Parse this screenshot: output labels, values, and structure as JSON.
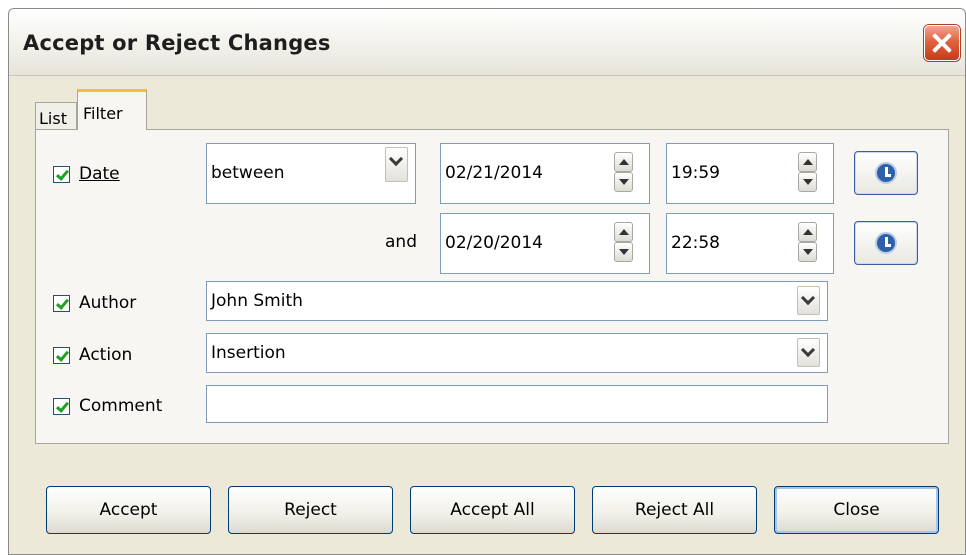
{
  "window": {
    "title": "Accept or Reject Changes"
  },
  "tabs": [
    {
      "label": "List"
    },
    {
      "label": "Filter"
    }
  ],
  "filter": {
    "date": {
      "label": "Date",
      "checked": true,
      "mode": "between",
      "start_date": "02/21/2014",
      "start_time": "19:59",
      "and_label": "and",
      "end_date": "02/20/2014",
      "end_time": "22:58"
    },
    "author": {
      "label": "Author",
      "checked": true,
      "value": "John Smith"
    },
    "action": {
      "label": "Action",
      "checked": true,
      "value": "Insertion"
    },
    "comment": {
      "label": "Comment",
      "checked": true,
      "value": ""
    }
  },
  "buttons": {
    "accept": "Accept",
    "reject": "Reject",
    "accept_all": "Accept All",
    "reject_all": "Reject All",
    "close": "Close"
  },
  "icons": {
    "close": "close-icon",
    "clock": "clock-icon",
    "dropdown": "chevron-down-icon"
  },
  "colors": {
    "checkmark": "#21a121",
    "title_close_button": "#e2623f",
    "active_tab_accent": "#f9bb3e"
  }
}
